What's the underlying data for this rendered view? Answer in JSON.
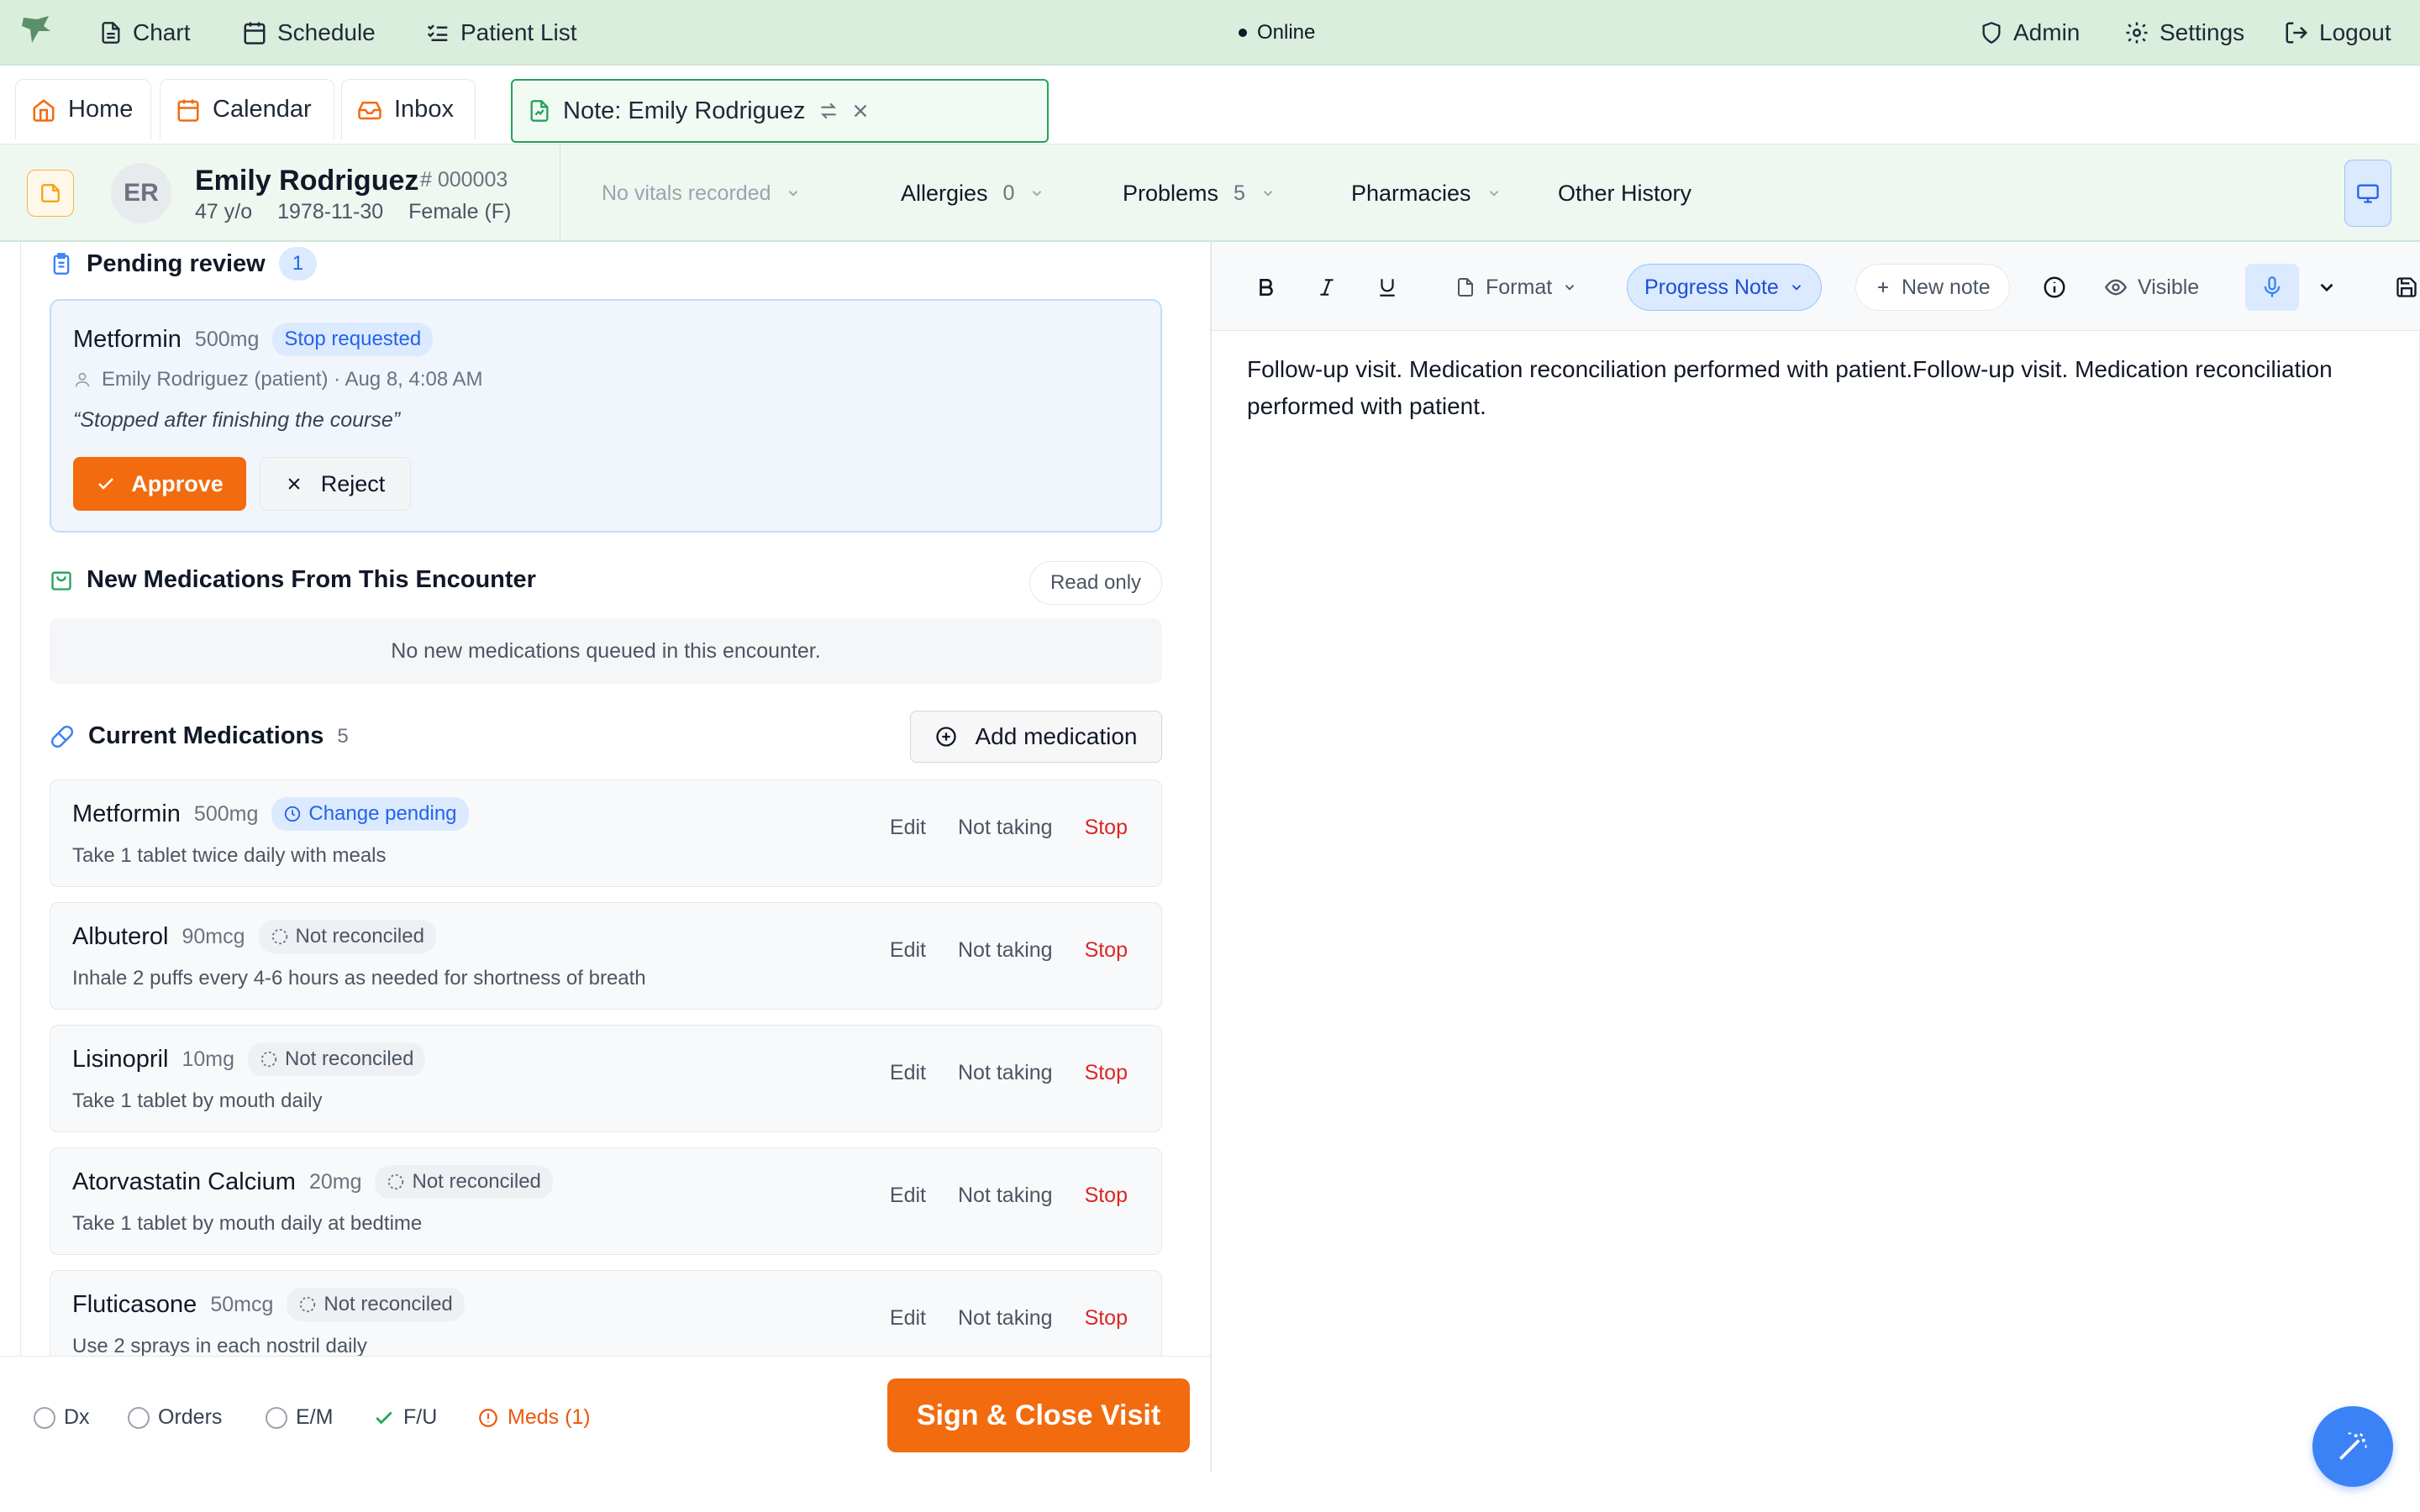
{
  "colors": {
    "accent_green": "#22a35a",
    "orange": "#f26b0f",
    "blue": "#2563eb",
    "stop_red": "#dc2626"
  },
  "topnav": {
    "items": [
      {
        "label": "Chart",
        "icon": "document-icon"
      },
      {
        "label": "Schedule",
        "icon": "calendar-icon"
      },
      {
        "label": "Patient List",
        "icon": "list-check-icon"
      }
    ],
    "status": "Online",
    "right": [
      {
        "label": "Admin",
        "icon": "shield-icon"
      },
      {
        "label": "Settings",
        "icon": "gear-icon"
      },
      {
        "label": "Logout",
        "icon": "logout-icon"
      }
    ]
  },
  "tabs": [
    {
      "label": "Home",
      "icon": "home-icon"
    },
    {
      "label": "Calendar",
      "icon": "calendar-icon"
    },
    {
      "label": "Inbox",
      "icon": "inbox-icon"
    },
    {
      "label": "Note: Emily Rodriguez",
      "icon": "note-icon",
      "active": true
    }
  ],
  "patient": {
    "initials": "ER",
    "name": "Emily Rodriguez",
    "id": "# 000003",
    "age": "47 y/o",
    "dob": "1978-11-30",
    "sex": "Female (F)",
    "vitals": "No vitals recorded",
    "allergies": {
      "label": "Allergies",
      "count": "0"
    },
    "problems": {
      "label": "Problems",
      "count": "5"
    },
    "pharmacies": "Pharmacies",
    "other_history": "Other History"
  },
  "pending": {
    "title": "Pending review",
    "count": "1",
    "med": "Metformin",
    "dose": "500mg",
    "status": "Stop requested",
    "requester": "Emily Rodriguez (patient) · Aug 8, 4:08 AM",
    "quote": "“Stopped after finishing the course”",
    "approve": "Approve",
    "reject": "Reject"
  },
  "new_meds": {
    "title": "New Medications From This Encounter",
    "badge": "Read only",
    "empty": "No new medications queued in this encounter."
  },
  "current_meds": {
    "title": "Current Medications",
    "count": "5",
    "add_label": "Add medication",
    "actions": {
      "edit": "Edit",
      "not_taking": "Not taking",
      "stop": "Stop"
    },
    "items": [
      {
        "name": "Metformin",
        "dose": "500mg",
        "status": "Change pending",
        "status_kind": "pending",
        "sig": "Take 1 tablet twice daily with meals"
      },
      {
        "name": "Albuterol",
        "dose": "90mcg",
        "status": "Not reconciled",
        "status_kind": "gray",
        "sig": "Inhale 2 puffs every 4-6 hours as needed for shortness of breath"
      },
      {
        "name": "Lisinopril",
        "dose": "10mg",
        "status": "Not reconciled",
        "status_kind": "gray",
        "sig": "Take 1 tablet by mouth daily"
      },
      {
        "name": "Atorvastatin Calcium",
        "dose": "20mg",
        "status": "Not reconciled",
        "status_kind": "gray",
        "sig": "Take 1 tablet by mouth daily at bedtime"
      },
      {
        "name": "Fluticasone",
        "dose": "50mcg",
        "status": "Not reconciled",
        "status_kind": "gray",
        "sig": "Use 2 sprays in each nostril daily"
      }
    ]
  },
  "checklist": [
    {
      "label": "Dx",
      "state": "empty"
    },
    {
      "label": "Orders",
      "state": "empty"
    },
    {
      "label": "E/M",
      "state": "empty"
    },
    {
      "label": "F/U",
      "state": "done"
    },
    {
      "label": "Meds (1)",
      "state": "warning"
    }
  ],
  "sign_button": "Sign & Close Visit",
  "editor": {
    "format": "Format",
    "note_type": "Progress Note",
    "new_note": "New note",
    "visibility": "Visible",
    "text": "Follow-up visit. Medication reconciliation performed with patient.Follow-up visit. Medication reconciliation performed with patient."
  }
}
